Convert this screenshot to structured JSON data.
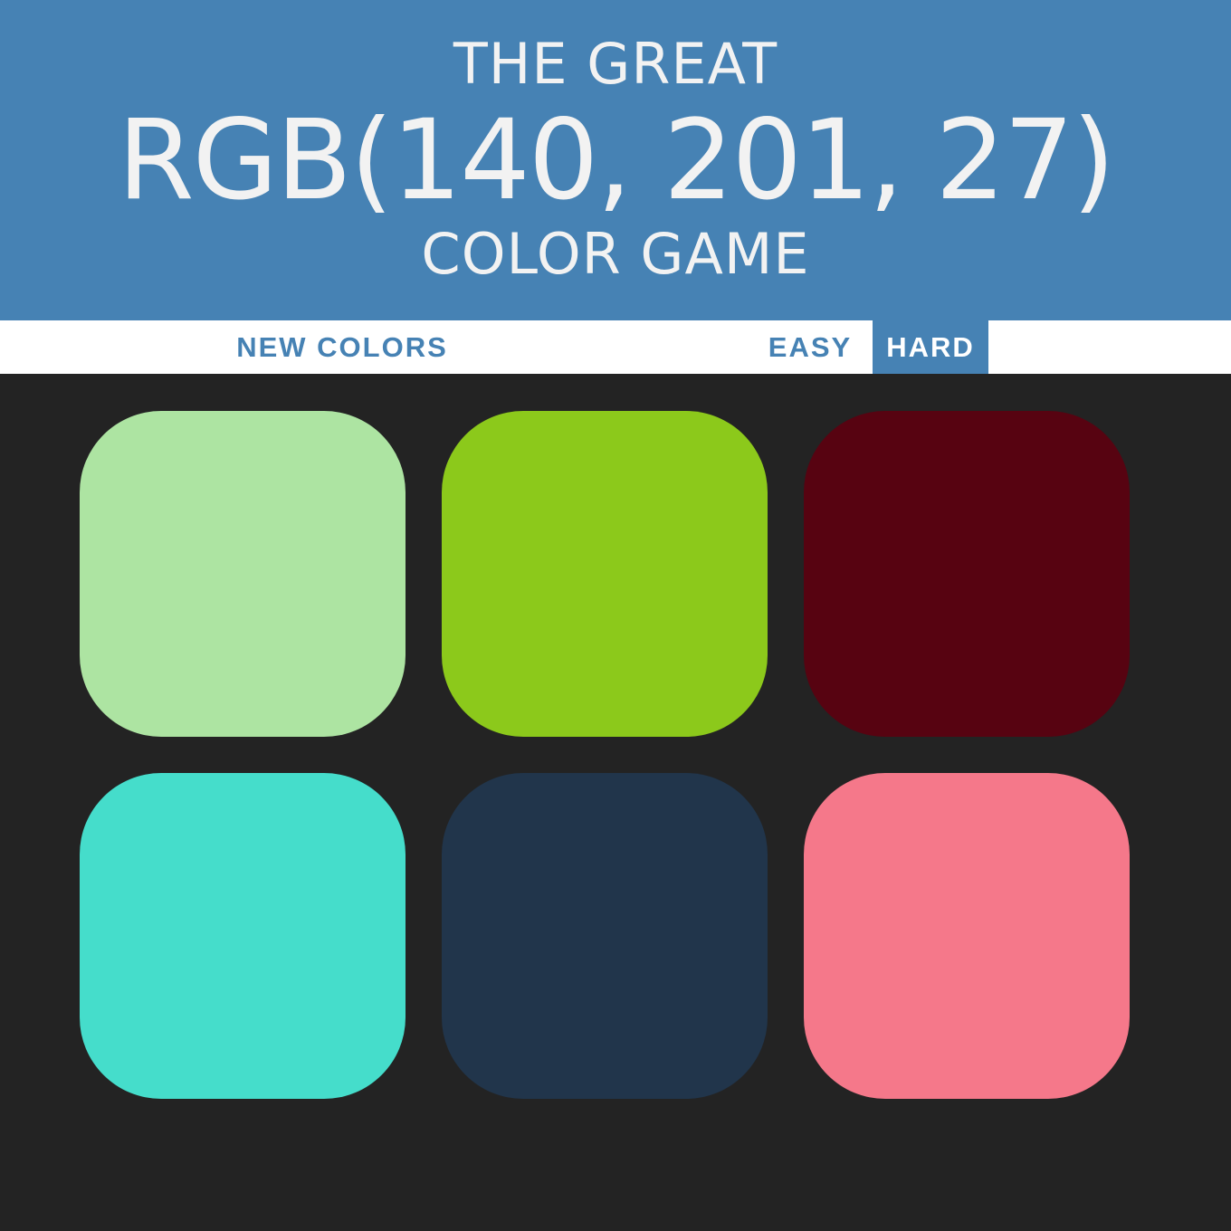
{
  "header": {
    "line1": "THE GREAT",
    "target_rgb": "RGB(140, 201, 27)",
    "line3": "COLOR GAME",
    "background": "#4682b4"
  },
  "controls": {
    "new_colors_label": "NEW COLORS",
    "message": "",
    "easy_label": "EASY",
    "hard_label": "HARD",
    "selected_mode": "hard"
  },
  "squares": [
    {
      "color": "#ade4a2"
    },
    {
      "color": "#8cc91b"
    },
    {
      "color": "#570311"
    },
    {
      "color": "#45ddcb"
    },
    {
      "color": "#21354b"
    },
    {
      "color": "#f5788a"
    }
  ],
  "background": "#232323"
}
